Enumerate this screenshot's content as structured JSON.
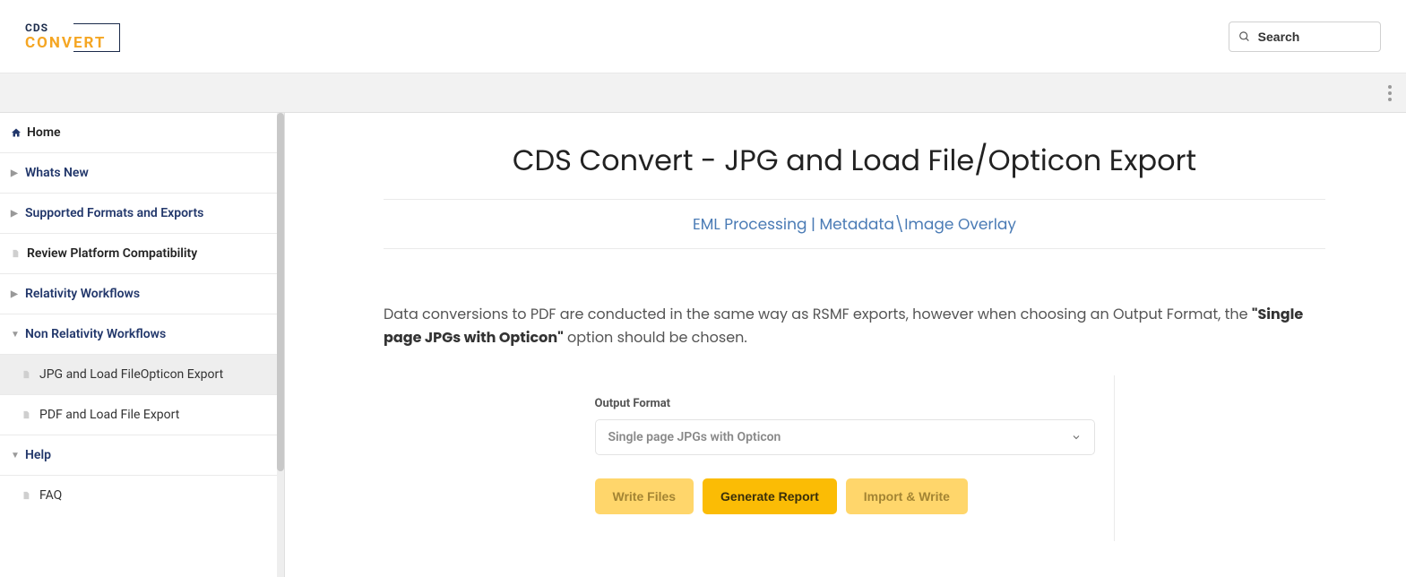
{
  "header": {
    "logo_top": "CDS",
    "logo_bottom": "CONVERT",
    "search_placeholder": "Search"
  },
  "sidebar": {
    "home": "Home",
    "items": [
      {
        "label": "Whats New",
        "style": "blue",
        "expanded": false
      },
      {
        "label": "Supported Formats and Exports",
        "style": "blue",
        "expanded": false
      },
      {
        "label": "Review Platform Compatibility",
        "style": "black-doc",
        "expanded": false
      },
      {
        "label": "Relativity Workflows",
        "style": "blue",
        "expanded": false
      },
      {
        "label": "Non Relativity Workflows",
        "style": "blue",
        "expanded": true,
        "children": [
          {
            "label": "JPG and Load FileOpticon Export",
            "active": true
          },
          {
            "label": "PDF and Load File Export",
            "active": false
          }
        ]
      },
      {
        "label": "Help",
        "style": "blue",
        "expanded": true,
        "children": [
          {
            "label": "FAQ",
            "active": false
          }
        ]
      }
    ]
  },
  "main": {
    "title": "CDS Convert - JPG and Load File/Opticon Export",
    "link1": "EML Processing",
    "sep": " | ",
    "link2": "Metadata\\Image Overlay",
    "para_pre": "Data conversions to PDF are conducted in the same way as RSMF exports, however when choosing an Output Format, the ",
    "para_bold": "\"Single page JPGs with Opticon\"",
    "para_post": " option should be chosen.",
    "panel": {
      "label": "Output Format",
      "selected": "Single page JPGs with Opticon",
      "buttons": {
        "write": "Write Files",
        "generate": "Generate Report",
        "import": "Import & Write"
      }
    }
  }
}
